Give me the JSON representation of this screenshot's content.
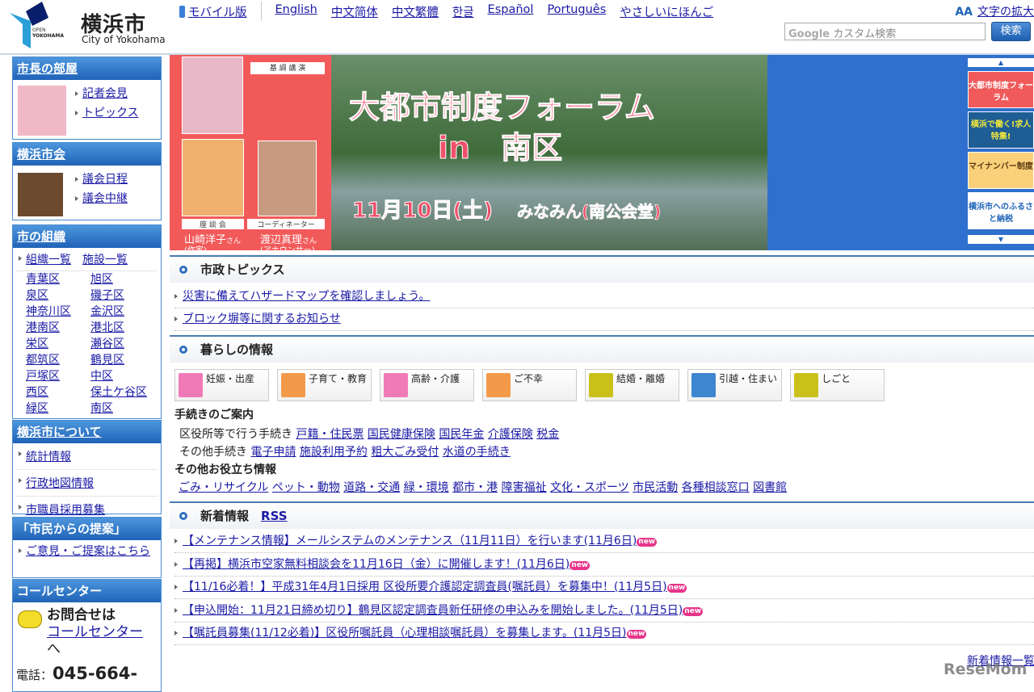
{
  "header": {
    "logo_open": "OPEN",
    "logo_yokohama": "YOKOHAMA",
    "city_name": "横浜市",
    "city_name_en": "City of Yokohama",
    "languages": [
      "モバイル版",
      "English",
      "中文简体",
      "中文繁體",
      "한글",
      "Español",
      "Português",
      "やさしいにほんご"
    ],
    "font_size_label": "文字の拡大",
    "search_placeholder": "カスタム検索",
    "search_brand": "Google",
    "search_button": "検索"
  },
  "sidebar": {
    "mayor": {
      "title": "市長の部屋",
      "links": [
        "記者会見",
        "トピックス"
      ]
    },
    "council": {
      "title": "横浜市会",
      "links": [
        "議会日程",
        "議会中継"
      ]
    },
    "org": {
      "title": "市の組織",
      "links": [
        "組織一覧",
        "施設一覧"
      ],
      "wards": [
        "青葉区",
        "旭区",
        "泉区",
        "磯子区",
        "神奈川区",
        "金沢区",
        "港南区",
        "港北区",
        "栄区",
        "瀬谷区",
        "都筑区",
        "鶴見区",
        "戸塚区",
        "中区",
        "西区",
        "保土ケ谷区",
        "緑区",
        "南区"
      ]
    },
    "about": {
      "title": "横浜市について",
      "links": [
        "統計情報",
        "行政地図情報",
        "市職員採用募集"
      ]
    },
    "proposal": {
      "title": "「市民からの提案」",
      "links": [
        "ご意見・ご提案はこちら"
      ]
    },
    "callcenter": {
      "title": "コールセンター",
      "text1": "お問合せは",
      "link": "コールセンター",
      "text2": "へ",
      "phone_label": "電話：",
      "phone": "045-664-"
    }
  },
  "banner": {
    "title1": "大都市制度フォーラム",
    "title2": "in　南区",
    "date": "11月10日(土)",
    "venue": "みなみん(南公会堂)",
    "label_keynote": "基 調 講 演",
    "label_panel": "座 談 会",
    "label_coord": "コーディネーター",
    "person1": "山崎洋子",
    "person1_role": "(作家)",
    "person2": "渡辺真理",
    "person2_role": "(アナウンサー)",
    "san": "さん",
    "thumbs": [
      "大都市制度フォーラム",
      "横浜で働く!求人特集!",
      "マイナンバー制度",
      "横浜市へのふるさと納税"
    ]
  },
  "topics": {
    "title": "市政トピックス",
    "items": [
      "災害に備えてハザードマップを確認しましょう。",
      "ブロック塀等に関するお知らせ"
    ]
  },
  "life": {
    "title": "暮らしの情報",
    "categories": [
      {
        "label": "妊娠・出産",
        "color": "#f07ab8"
      },
      {
        "label": "子育て・教育",
        "color": "#f39a4a"
      },
      {
        "label": "高齢・介護",
        "color": "#f07ab8"
      },
      {
        "label": "ご不幸",
        "color": "#f39a4a"
      },
      {
        "label": "結婚・離婚",
        "color": "#c9c11a"
      },
      {
        "label": "引越・住まい",
        "color": "#3f86d0"
      },
      {
        "label": "しごと",
        "color": "#c9c11a"
      }
    ],
    "procedures_title": "手続きのご案内",
    "ward_label": "区役所等で行う手続き",
    "ward_links": [
      "戸籍・住民票",
      "国民健康保険",
      "国民年金",
      "介護保険",
      "税金"
    ],
    "other_label": "その他手続き",
    "other_links": [
      "電子申請",
      "施設利用予約",
      "粗大ごみ受付",
      "水道の手続き"
    ],
    "useful_title": "その他お役立ち情報",
    "useful_links": [
      "ごみ・リサイクル",
      "ペット・動物",
      "道路・交通",
      "緑・環境",
      "都市・港",
      "障害福祉",
      "文化・スポーツ",
      "市民活動",
      "各種相談窓口",
      "図書館"
    ]
  },
  "news": {
    "title": "新着情報",
    "rss": "RSS",
    "new_badge": "new",
    "items": [
      "【メンテナンス情報】メールシステムのメンテナンス（11月11日）を行います(11月6日)",
      "【再掲】横浜市空家無料相談会を11月16日（金）に開催します！(11月6日)",
      "【11/16必着！】平成31年4月1日採用 区役所要介護認定調査員(嘱託員）を募集中！(11月5日)",
      "【申込開始：11月21日締め切り】鶴見区認定調査員新任研修の申込みを開始しました。(11月5日)",
      "【嘱託員募集(11/12必着)】区役所嘱託員（心理相談嘱託員）を募集します。(11月5日)"
    ],
    "more": "新着情報一覧"
  },
  "watermark": "ReseMom"
}
